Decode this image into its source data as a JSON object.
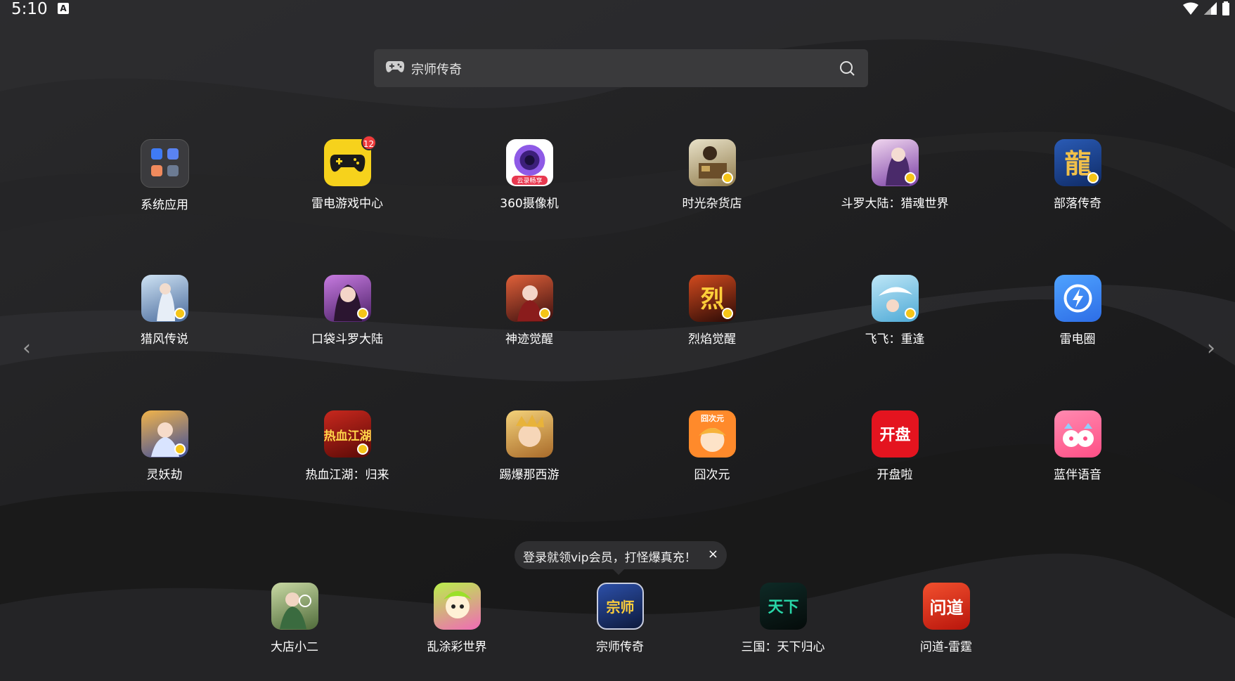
{
  "status_bar": {
    "time": "5:10",
    "indicator": "A"
  },
  "search": {
    "value": "宗师传奇"
  },
  "apps": [
    {
      "label": "系统应用",
      "icon": "folder-icon"
    },
    {
      "label": "雷电游戏中心",
      "icon": "gamepad-icon",
      "badge": "12"
    },
    {
      "label": "360摄像机",
      "icon": "camera-icon",
      "tag": "云录畅享"
    },
    {
      "label": "时光杂货店",
      "icon": "game-icon"
    },
    {
      "label": "斗罗大陆：猎魂世界",
      "icon": "game-icon"
    },
    {
      "label": "部落传奇",
      "icon": "game-icon",
      "glyph": "龍"
    },
    {
      "label": "猎风传说",
      "icon": "game-icon"
    },
    {
      "label": "口袋斗罗大陆",
      "icon": "game-icon"
    },
    {
      "label": "神迹觉醒",
      "icon": "game-icon"
    },
    {
      "label": "烈焰觉醒",
      "icon": "game-icon",
      "glyph": "烈"
    },
    {
      "label": "飞飞：重逢",
      "icon": "game-icon"
    },
    {
      "label": "雷电圈",
      "icon": "lightning-icon"
    },
    {
      "label": "灵妖劫",
      "icon": "game-icon"
    },
    {
      "label": "热血江湖：归来",
      "icon": "game-icon",
      "glyph": "热血江湖"
    },
    {
      "label": "踢爆那西游",
      "icon": "game-icon"
    },
    {
      "label": "囧次元",
      "icon": "anime-icon",
      "glyph": "囧次元"
    },
    {
      "label": "开盘啦",
      "icon": "kaipan-icon",
      "glyph": "开盘"
    },
    {
      "label": "蓝伴语音",
      "icon": "voice-icon"
    }
  ],
  "dock": [
    {
      "label": "大店小二",
      "icon": "game-icon"
    },
    {
      "label": "乱涂彩世界",
      "icon": "game-icon"
    },
    {
      "label": "宗师传奇",
      "icon": "game-icon",
      "glyph": "宗师"
    },
    {
      "label": "三国：天下归心",
      "icon": "game-icon",
      "glyph": "天下"
    },
    {
      "label": "问道-雷霆",
      "icon": "game-icon",
      "glyph": "问道"
    }
  ],
  "tooltip": {
    "text": "登录就领vip会员，打怪爆真充！",
    "close": "×"
  },
  "nav": {
    "prev": "‹",
    "next": "›"
  }
}
